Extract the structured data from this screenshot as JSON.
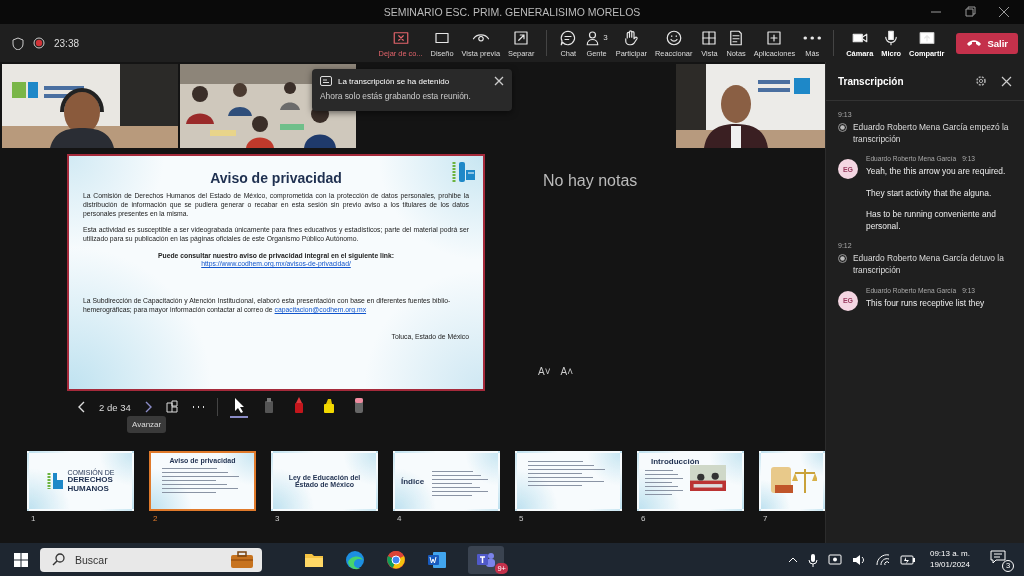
{
  "window": {
    "title": "SEMINARIO ESC. PRIM. GENERALISIMO MORELOS"
  },
  "meeting": {
    "elapsed": "23:38",
    "recording": true
  },
  "toolbar": [
    [
      {
        "label": "Dejar de co...",
        "kind": "stop"
      },
      {
        "label": "Diseño",
        "kind": "layout"
      },
      {
        "label": "Vista previa",
        "kind": "eye"
      },
      {
        "label": "Separar",
        "kind": "popout"
      }
    ],
    [
      {
        "label": "Chat",
        "kind": "chat"
      },
      {
        "label": "Gente",
        "kind": "people",
        "count": "3"
      },
      {
        "label": "Participar",
        "kind": "hand"
      },
      {
        "label": "Reaccionar",
        "kind": "smile"
      },
      {
        "label": "Vista",
        "kind": "grid"
      },
      {
        "label": "Notas",
        "kind": "notes"
      },
      {
        "label": "Aplicaciones",
        "kind": "apps"
      },
      {
        "label": "Más",
        "kind": "more"
      }
    ],
    [
      {
        "label": "Cámara",
        "kind": "camera"
      },
      {
        "label": "Micro",
        "kind": "mic"
      },
      {
        "label": "Compartir",
        "kind": "share"
      }
    ]
  ],
  "leave_button": "Salir",
  "toast": {
    "title": "La transcripción se ha detenido",
    "message": "Ahora solo estás grabando esta reunión."
  },
  "slide": {
    "title": "Aviso de privacidad",
    "paragraphs": [
      "La Comisión de Derechos Humanos del Estado de México, comprometida con la protección de datos personales, prohibe la distribución de información que se pudiera generar o recabar en esta sesión sin previo aviso a los titulares de los datos personales presentes en la misma.",
      "Esta actividad es susceptible a ser videograbada únicamente para fines educativos y estadísticos; parte del material podrá ser utilizado para su publicación en las páginas oficiales de este Organismo Público Autónomo."
    ],
    "link_lead": "Puede consultar nuestro aviso de privacidad integral en el siguiente link:",
    "link": "https://www.codhem.org.mx/avisos-de-privacidad/",
    "credit": "La Subdirección de Capacitación y Atención Institucional, elaboró esta presentación con base en diferentes fuentes biblio-hemerográficas; para mayor información contactar al correo de",
    "email": "capacitacion@codhem.org.mx",
    "place": "Toluca, Estado de México"
  },
  "notes": "No hay notas",
  "font_buttons": [
    "A˅",
    "A˄"
  ],
  "slide_nav": {
    "counter": "2 de 34",
    "tooltip": "Avanzar"
  },
  "tools": [
    {
      "kind": "pointer",
      "selected": true
    },
    {
      "kind": "eraser",
      "selected": false
    },
    {
      "kind": "pen",
      "selected": false
    },
    {
      "kind": "highlighter",
      "selected": false
    },
    {
      "kind": "rubber",
      "selected": false
    }
  ],
  "thumbnails": [
    {
      "number": "1",
      "selected": false,
      "kind": "logo",
      "lines": [
        "COMISIÓN DE",
        "DERECHOS",
        "HUMANOS"
      ]
    },
    {
      "number": "2",
      "selected": true,
      "kind": "text",
      "title": "Aviso de privacidad"
    },
    {
      "number": "3",
      "selected": false,
      "kind": "title",
      "title": "Ley de Educación del Estado de México"
    },
    {
      "number": "4",
      "selected": false,
      "kind": "index",
      "title": "Índice"
    },
    {
      "number": "5",
      "selected": false,
      "kind": "text"
    },
    {
      "number": "6",
      "selected": false,
      "title": "Introducción"
    },
    {
      "number": "7",
      "selected": false,
      "kind": "drawing"
    }
  ],
  "transcript": {
    "title": "Transcripción",
    "entries": [
      {
        "kind": "event",
        "time": "9:13",
        "text": "Eduardo Roberto Mena García empezó la transcripción"
      },
      {
        "kind": "speech",
        "initials": "EG",
        "name": "Eduardo Roberto Mena García",
        "time": "9:13",
        "lines": [
          "Yeah, the this arrow you are required.",
          "They start activity that the alguna.",
          "Has to be running conveniente and personal."
        ]
      },
      {
        "kind": "event",
        "time": "9:12",
        "text": "Eduardo Roberto Mena García detuvo la transcripción"
      },
      {
        "kind": "speech",
        "initials": "EG",
        "name": "Eduardo Roberto Mena García",
        "time": "9:13",
        "lines": [
          "This four runs receptive list they"
        ]
      }
    ]
  },
  "taskbar": {
    "search": "Buscar",
    "teams_badge": "9+",
    "time": "09:13 a. m.",
    "date": "19/01/2024",
    "notifications": "3"
  }
}
